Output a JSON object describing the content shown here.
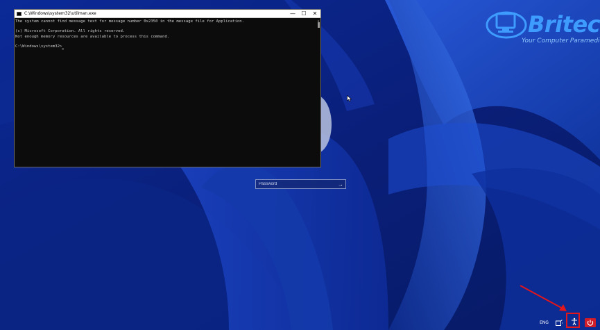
{
  "brand": {
    "name": "Britec",
    "tagline": "Your Computer Paramedic"
  },
  "cmd_window": {
    "title": "C:\\Windows\\system32\\utilman.exe",
    "lines": [
      "The system cannot find message text for message number 0x2350 in the message file for Application.",
      "",
      "(c) Microsoft Corporation. All rights reserved.",
      "Not enough memory resources are available to process this command.",
      "",
      "C:\\Windows\\system32>"
    ],
    "minimize_glyph": "—",
    "maximize_glyph": "☐",
    "close_glyph": "✕"
  },
  "login": {
    "password_placeholder": "Password",
    "submit_glyph": "→"
  },
  "tray": {
    "language": "ENG",
    "icons": [
      "network-icon",
      "accessibility-icon",
      "power-icon"
    ]
  },
  "colors": {
    "highlight": "#e3161b",
    "wallpaper_dark": "#06206e",
    "wallpaper_light": "#2f63e0",
    "brand_blue": "#3e9cff"
  }
}
